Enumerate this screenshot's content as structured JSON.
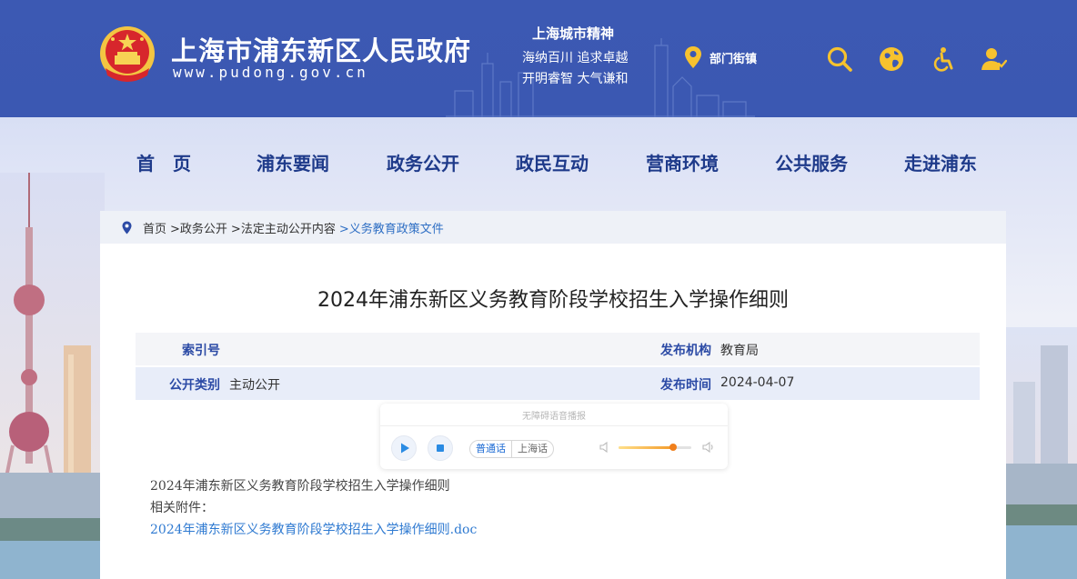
{
  "header": {
    "site_title": "上海市浦东新区人民政府",
    "site_url": "www.pudong.gov.cn",
    "spirit": {
      "title": "上海城市精神",
      "line1": "海纳百川  追求卓越",
      "line2": "开明睿智  大气谦和"
    },
    "dept_link": "部门街镇",
    "icons": [
      "map-pin-icon",
      "search-icon",
      "globe-icon",
      "accessibility-icon",
      "user-icon"
    ],
    "colors": {
      "header_bg": "#3c59b3",
      "icon_accent": "#f7c22e"
    }
  },
  "nav": {
    "items": [
      "首　页",
      "浦东要闻",
      "政务公开",
      "政民互动",
      "营商环境",
      "公共服务",
      "走进浦东"
    ]
  },
  "breadcrumb": {
    "items": [
      {
        "label": "首页"
      },
      {
        "label": ">政务公开"
      },
      {
        "label": ">法定主动公开内容"
      },
      {
        "label": ">义务教育政策文件"
      }
    ]
  },
  "article": {
    "title": "2024年浦东新区义务教育阶段学校招生入学操作细则",
    "meta": {
      "index_label": "索引号",
      "index_value": "",
      "publisher_label": "发布机构",
      "publisher_value": "教育局",
      "category_label": "公开类别",
      "category_value": "主动公开",
      "date_label": "发布时间",
      "date_value": "2024-04-07"
    },
    "reader": {
      "title": "无障碍语音播报",
      "lang_options": [
        "普通话",
        "上海话"
      ],
      "selected_lang": "普通话",
      "volume": 0.75
    },
    "body": {
      "line1": "2024年浦东新区义务教育阶段学校招生入学操作细则",
      "attachment_label": "相关附件：",
      "attachment_link": "2024年浦东新区义务教育阶段学校招生入学操作细则.doc"
    }
  }
}
